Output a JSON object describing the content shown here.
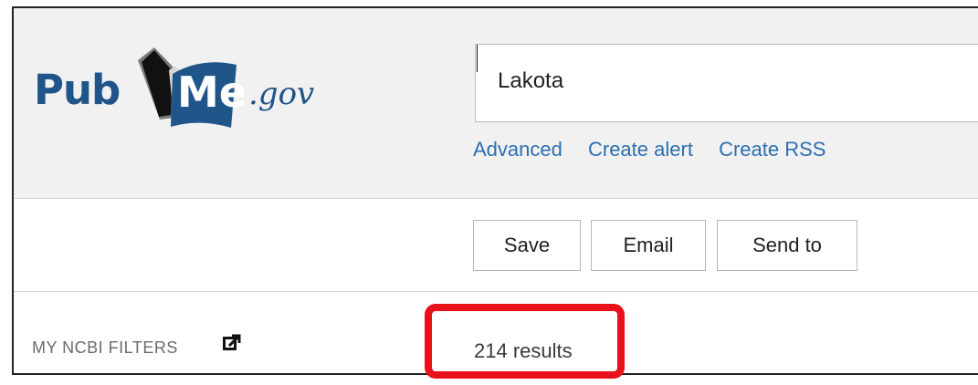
{
  "logo": {
    "pub": "Pub",
    "med": "Med",
    "gov": ".gov"
  },
  "search": {
    "value": "Lakota"
  },
  "search_links": {
    "advanced": "Advanced",
    "create_alert": "Create alert",
    "create_rss": "Create RSS"
  },
  "toolbar": {
    "save_label": "Save",
    "email_label": "Email",
    "send_to_label": "Send to"
  },
  "filters": {
    "label": "MY NCBI FILTERS"
  },
  "results": {
    "count_text": "214 results"
  },
  "colors": {
    "brand_blue": "#20558a",
    "link_blue": "#2c6fb0",
    "highlight_red": "#e8101a",
    "header_bg": "#f1f1f1"
  }
}
